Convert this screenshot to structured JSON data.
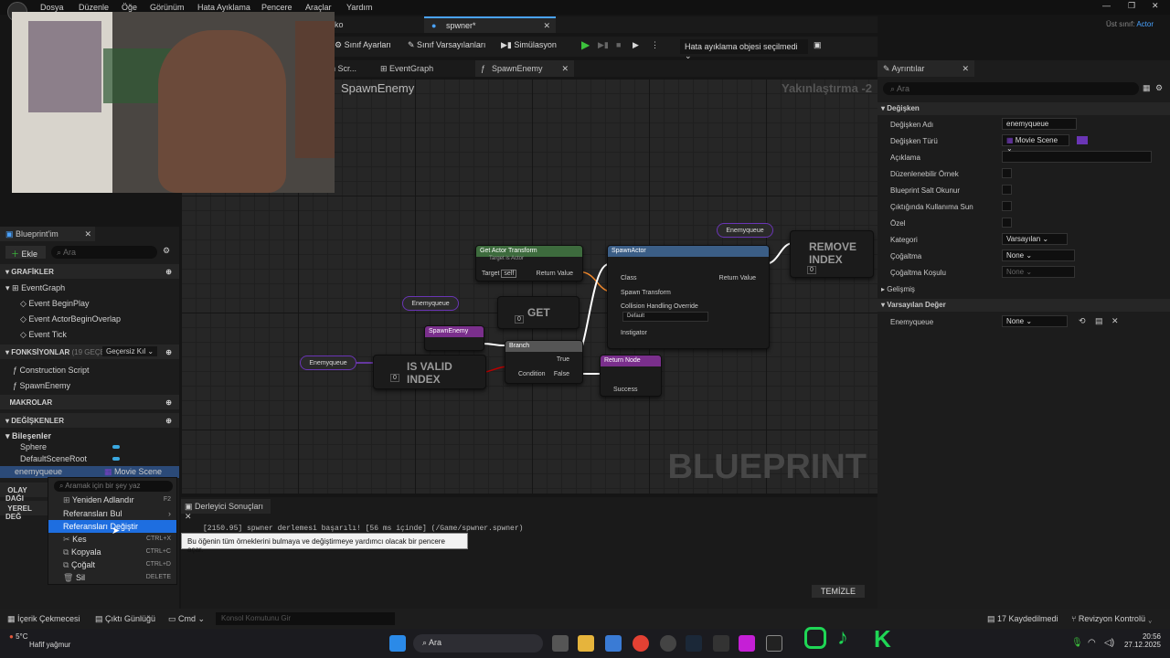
{
  "menu": [
    "Dosya",
    "Düzenle",
    "Öğe",
    "Görünüm",
    "Hata Ayıklama",
    "Pencere",
    "Araçlar",
    "Yardım"
  ],
  "title_right": {
    "label": "Üst sınıf:",
    "value": "Actor"
  },
  "doc_tabs": {
    "partial": "ko",
    "active": "spwner*"
  },
  "toolbar": {
    "class_settings": "Sınıf Ayarları",
    "class_defaults": "Sınıf Varsayılanları",
    "simulation": "Simülasyon",
    "debug_object": "Hata ayıklama objesi seçilmedi"
  },
  "graph_tabs": {
    "partial": "n Scr...",
    "event_graph": "EventGraph",
    "spawn_enemy": "SpawnEnemy"
  },
  "graph": {
    "title": "SpawnEnemy",
    "zoom": "Yakınlaştırma -2",
    "watermark": "BLUEPRINT"
  },
  "nodes": {
    "enemyqueue": "Enemyqueue",
    "get_actor_transform": "Get Actor Transform",
    "target_is_actor": "Target is Actor",
    "target": "Target",
    "self": "self",
    "return_value": "Return Value",
    "spawn_actor": "SpawnActor",
    "class": "Class",
    "spawn_transform": "Spawn Transform",
    "collision": "Collision Handling Override",
    "default": "Default",
    "instigator": "Instigator",
    "remove_index": "REMOVE INDEX",
    "get": "GET",
    "spawn_enemy_call": "SpawnEnemy",
    "branch": "Branch",
    "condition": "Condition",
    "true": "True",
    "false": "False",
    "is_valid_index": "IS VALID INDEX",
    "return_node": "Return Node",
    "success": "Success",
    "zero": "0"
  },
  "my_blueprint": {
    "title": "Blueprint'im",
    "add": "Ekle",
    "search": "Ara",
    "graphs": "GRAFİKLER",
    "event_graph": "EventGraph",
    "events": [
      "Event BeginPlay",
      "Event ActorBeginOverlap",
      "Event Tick"
    ],
    "functions": "FONKSİYONLAR",
    "functions_count": "(19 GEÇERSİZ",
    "override": "Geçersiz Kıl",
    "func_items": [
      "Construction Script",
      "SpawnEnemy"
    ],
    "macros": "MAKROLAR",
    "variables": "DEĞİŞKENLER",
    "components": "Bileşenler",
    "comp_items": [
      "Sphere",
      "DefaultSceneRoot"
    ],
    "selected_var": "enemyqueue",
    "selected_type": "Movie Scene",
    "event_dispatchers": "OLAY DAĞI",
    "local_vars": "YEREL DEĞ"
  },
  "context_menu": {
    "search": "Aramak için bir şey yaz",
    "items": [
      {
        "label": "Yeniden Adlandır",
        "shortcut": "F2"
      },
      {
        "label": "Referansları Bul",
        "shortcut": ""
      },
      {
        "label": "Referansları Değiştir",
        "shortcut": ""
      },
      {
        "label": "Kes",
        "shortcut": "CTRL+X"
      },
      {
        "label": "Kopyala",
        "shortcut": "CTRL+C"
      },
      {
        "label": "Çoğalt",
        "shortcut": "CTRL+D"
      },
      {
        "label": "Sil",
        "shortcut": "DELETE"
      }
    ],
    "tooltip": "Bu öğenin tüm örneklerini bulmaya ve değiştirmeye yardımcı olacak bir pencere açar."
  },
  "compiler": {
    "tab": "Derleyici Sonuçları",
    "log": "[2150.95] spwner derlemesi başarılı! [56 ms içinde] (/Game/spwner.spwner)",
    "clear": "TEMİZLE"
  },
  "details": {
    "tab": "Ayrıntılar",
    "search": "Ara",
    "section": "Değişken",
    "rows": [
      "Değişken Adı",
      "Değişken Türü",
      "Açıklama",
      "Düzenlenebilir Örnek",
      "Blueprint Salt Okunur",
      "Çıktığında Kullanıma Sun",
      "Özel",
      "Kategori",
      "Çoğaltma",
      "Çoğaltma Koşulu"
    ],
    "var_name": "enemyqueue",
    "var_type": "Movie Scene",
    "category": "Varsayılan",
    "replication": "None",
    "rep_condition": "None",
    "advanced": "Gelişmiş",
    "default_section": "Varsayılan Değer",
    "default_row": "Enemyqueue",
    "default_value": "None"
  },
  "statusbar": {
    "content": "İçerik Çekmecesi",
    "output": "Çıktı Günlüğü",
    "cmd": "Cmd",
    "console": "Konsol Komutunu Gir",
    "saved": "17 Kaydedilmedi",
    "revision": "Revizyon Kontrolü"
  },
  "taskbar": {
    "temp": "5°C",
    "weather": "Hafif yağmur",
    "search": "Ara",
    "time": "20:56",
    "date": "27.12.2025"
  }
}
